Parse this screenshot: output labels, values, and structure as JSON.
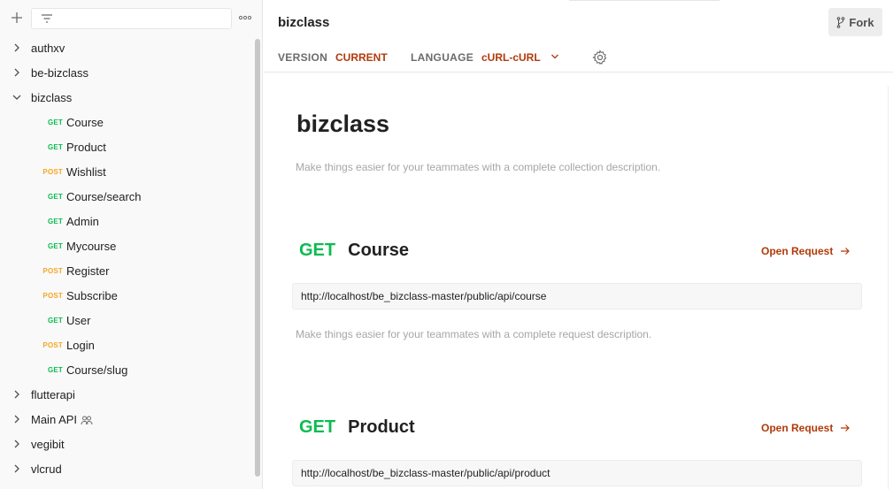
{
  "sidebar": {
    "items": [
      {
        "kind": "folder",
        "label": "authxv",
        "expanded": false
      },
      {
        "kind": "folder",
        "label": "be-bizclass",
        "expanded": false
      },
      {
        "kind": "folder",
        "label": "bizclass",
        "expanded": true
      },
      {
        "kind": "request",
        "method": "GET",
        "label": "Course"
      },
      {
        "kind": "request",
        "method": "GET",
        "label": "Product"
      },
      {
        "kind": "request",
        "method": "POST",
        "label": "Wishlist"
      },
      {
        "kind": "request",
        "method": "GET",
        "label": "Course/search"
      },
      {
        "kind": "request",
        "method": "GET",
        "label": "Admin"
      },
      {
        "kind": "request",
        "method": "GET",
        "label": "Mycourse"
      },
      {
        "kind": "request",
        "method": "POST",
        "label": "Register"
      },
      {
        "kind": "request",
        "method": "POST",
        "label": "Subscribe"
      },
      {
        "kind": "request",
        "method": "GET",
        "label": "User"
      },
      {
        "kind": "request",
        "method": "POST",
        "label": "Login"
      },
      {
        "kind": "request",
        "method": "GET",
        "label": "Course/slug"
      },
      {
        "kind": "folder",
        "label": "flutterapi",
        "expanded": false
      },
      {
        "kind": "folder",
        "label": "Main API",
        "expanded": false,
        "team_icon": "team-icon"
      },
      {
        "kind": "folder",
        "label": "vegibit",
        "expanded": false
      },
      {
        "kind": "folder",
        "label": "vlcrud",
        "expanded": false
      }
    ]
  },
  "header": {
    "title": "bizclass",
    "fork_label": "Fork",
    "version_label": "VERSION",
    "version_value": "CURRENT",
    "language_label": "LANGUAGE",
    "language_value": "cURL-cURL"
  },
  "main": {
    "title": "bizclass",
    "description": "Make things easier for your teammates with a complete collection description.",
    "requests": [
      {
        "method": "GET",
        "name": "Course",
        "open_label": "Open Request",
        "url": "http://localhost/be_bizclass-master/public/api/course",
        "description": "Make things easier for your teammates with a complete request description."
      },
      {
        "method": "GET",
        "name": "Product",
        "open_label": "Open Request",
        "url": "http://localhost/be_bizclass-master/public/api/product"
      }
    ]
  },
  "colors": {
    "get": "#0cbb52",
    "post": "#f5a623",
    "accent": "#b13a0b"
  }
}
